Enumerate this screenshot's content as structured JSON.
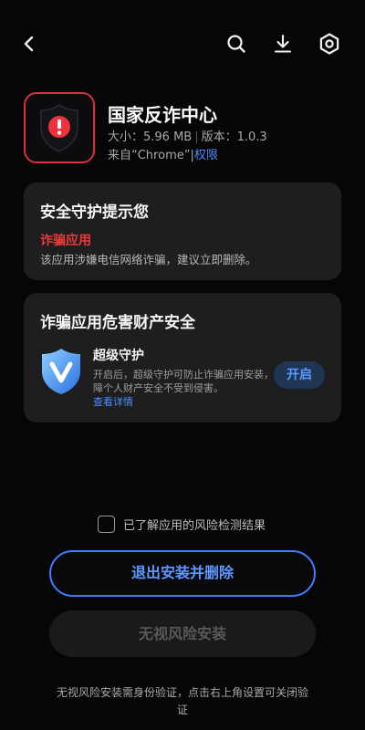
{
  "topbar": {
    "icons": [
      "back-arrow-icon",
      "search-icon",
      "download-icon",
      "settings-icon"
    ]
  },
  "app": {
    "name": "国家反诈中心",
    "size": "大小：5.96 MB",
    "version": "版本：1.0.3",
    "source": "来自“Chrome”",
    "permissions_link": "权限"
  },
  "security_card": {
    "title": "安全守护提示您",
    "risk_label": "诈骗应用",
    "risk_desc": "该应用涉嫌电信网络诈骗，建议立即删除。"
  },
  "guard_card": {
    "title": "诈骗应用危害财产安全",
    "guard_name": "超级守护",
    "guard_desc": "开启后，超级守护可防止诈骗应用安装，保障个人财产安全不受到侵害。",
    "details_link": "查看详情",
    "enable_button": "开启"
  },
  "acknowledge": {
    "checked": false,
    "label": "已了解应用的风险检测结果"
  },
  "buttons": {
    "exit_delete": "退出安装并删除",
    "ignore_install": "无视风险安装"
  },
  "footnote": "无视风险安装需身份验证，点击右上角设置可关闭验证",
  "colors": {
    "background": "#060606",
    "card": "#1e1e20",
    "accent_blue": "#3f7cff",
    "danger_red": "#ee3a3a"
  }
}
